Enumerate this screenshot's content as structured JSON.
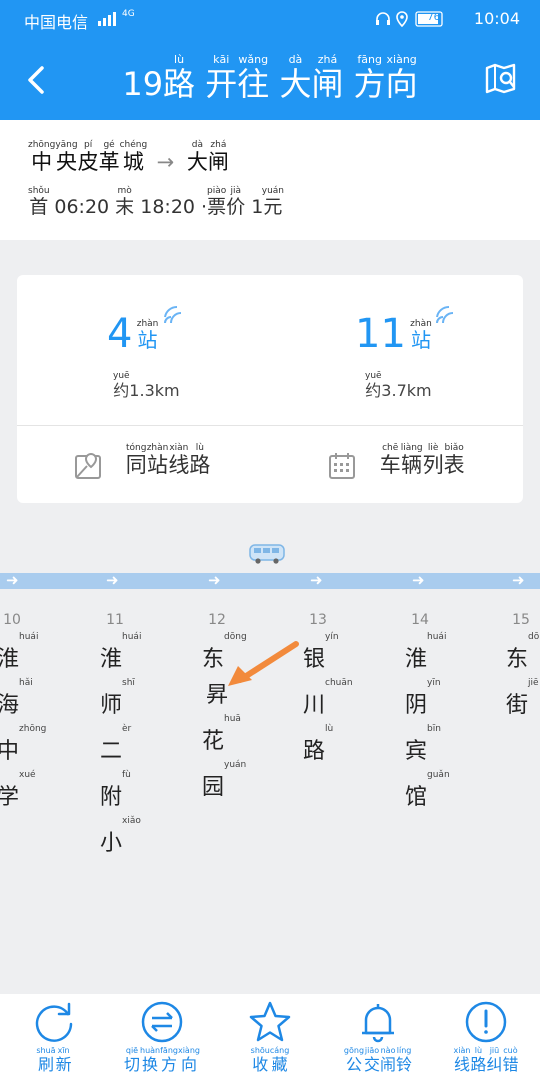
{
  "status_bar": {
    "carrier": "中国电信",
    "network": "4G",
    "battery": "76",
    "time": "10:04"
  },
  "header": {
    "title": [
      {
        "t": "19",
        "p": ""
      },
      {
        "t": "路",
        "p": "lù"
      },
      {
        "t": " ",
        "p": ""
      },
      {
        "t": "开",
        "p": "kāi"
      },
      {
        "t": "往",
        "p": "wǎng"
      },
      {
        "t": " ",
        "p": ""
      },
      {
        "t": "大",
        "p": "dà"
      },
      {
        "t": "闸",
        "p": "zhá"
      },
      {
        "t": " ",
        "p": ""
      },
      {
        "t": "方",
        "p": "fāng"
      },
      {
        "t": "向",
        "p": "xiàng"
      }
    ]
  },
  "route_info": {
    "from": [
      {
        "t": "中",
        "p": "zhōng"
      },
      {
        "t": "央",
        "p": "yāng"
      },
      {
        "t": "皮",
        "p": "pí"
      },
      {
        "t": "革",
        "p": "gé"
      },
      {
        "t": "城",
        "p": "chéng"
      }
    ],
    "arrow": "→",
    "to": [
      {
        "t": "大",
        "p": "dà"
      },
      {
        "t": "闸",
        "p": "zhá"
      }
    ],
    "first_label": {
      "t": "首",
      "p": "shǒu"
    },
    "first_time": "06:20",
    "last_label": {
      "t": "末",
      "p": "mò"
    },
    "last_time": "18:20",
    "fare_label": [
      {
        "t": "票",
        "p": "piào"
      },
      {
        "t": "价",
        "p": "jià"
      }
    ],
    "fare_prefix": "·",
    "fare_value": "1",
    "fare_unit": {
      "t": "元",
      "p": "yuán"
    }
  },
  "buses": [
    {
      "stops": "4",
      "unit": {
        "t": "站",
        "p": "zhàn"
      },
      "dist_prefix": {
        "t": "约",
        "p": "yuē"
      },
      "dist": "1.3km"
    },
    {
      "stops": "11",
      "unit": {
        "t": "站",
        "p": "zhàn"
      },
      "dist_prefix": {
        "t": "约",
        "p": "yuē"
      },
      "dist": "3.7km"
    }
  ],
  "card_buttons": [
    {
      "icon": "map-pin-icon",
      "label": [
        {
          "t": "同",
          "p": "tóng"
        },
        {
          "t": "站",
          "p": "zhàn"
        },
        {
          "t": "线",
          "p": "xiàn"
        },
        {
          "t": "路",
          "p": "lù"
        }
      ]
    },
    {
      "icon": "calendar-icon",
      "label": [
        {
          "t": "车",
          "p": "chē"
        },
        {
          "t": "辆",
          "p": "liàng"
        },
        {
          "t": "列",
          "p": "liè"
        },
        {
          "t": "表",
          "p": "biǎo"
        }
      ]
    }
  ],
  "stops": [
    {
      "index": "10",
      "chars": [
        {
          "t": "淮",
          "p": "huái"
        },
        {
          "t": "海",
          "p": "hǎi"
        },
        {
          "t": "中",
          "p": "zhōng"
        },
        {
          "t": "学",
          "p": "xué"
        }
      ]
    },
    {
      "index": "11",
      "chars": [
        {
          "t": "淮",
          "p": "huái"
        },
        {
          "t": "师",
          "p": "shī"
        },
        {
          "t": "二",
          "p": "èr"
        },
        {
          "t": "附",
          "p": "fù"
        },
        {
          "t": "小",
          "p": "xiǎo"
        }
      ]
    },
    {
      "index": "12",
      "chars": [
        {
          "t": "东",
          "p": "dōng"
        },
        {
          "t": "昇",
          "p": ""
        },
        {
          "t": "花",
          "p": "huā"
        },
        {
          "t": "园",
          "p": "yuán"
        }
      ]
    },
    {
      "index": "13",
      "chars": [
        {
          "t": "银",
          "p": "yín"
        },
        {
          "t": "川",
          "p": "chuān"
        },
        {
          "t": "路",
          "p": "lù"
        }
      ]
    },
    {
      "index": "14",
      "chars": [
        {
          "t": "淮",
          "p": "huái"
        },
        {
          "t": "阴",
          "p": "yīn"
        },
        {
          "t": "宾",
          "p": "bīn"
        },
        {
          "t": "馆",
          "p": "guǎn"
        }
      ]
    },
    {
      "index": "15",
      "chars": [
        {
          "t": "东",
          "p": "dōng"
        },
        {
          "t": "街",
          "p": "jiē"
        }
      ]
    }
  ],
  "bottom_tabs": [
    {
      "icon": "refresh-icon",
      "label": [
        {
          "t": "刷",
          "p": "shuā"
        },
        {
          "t": "新",
          "p": "xīn"
        }
      ]
    },
    {
      "icon": "switch-direction-icon",
      "label": [
        {
          "t": "切",
          "p": "qiē"
        },
        {
          "t": "换",
          "p": "huàn"
        },
        {
          "t": "方",
          "p": "fāng"
        },
        {
          "t": "向",
          "p": "xiàng"
        }
      ]
    },
    {
      "icon": "star-icon",
      "label": [
        {
          "t": "收",
          "p": "shōu"
        },
        {
          "t": "藏",
          "p": "cáng"
        }
      ]
    },
    {
      "icon": "bell-icon",
      "label": [
        {
          "t": "公",
          "p": "gōng"
        },
        {
          "t": "交",
          "p": "jiāo"
        },
        {
          "t": "闹",
          "p": "nào"
        },
        {
          "t": "铃",
          "p": "líng"
        }
      ]
    },
    {
      "icon": "info-icon",
      "label": [
        {
          "t": "线",
          "p": "xiàn"
        },
        {
          "t": "路",
          "p": "lù"
        },
        {
          "t": "纠",
          "p": "jiū"
        },
        {
          "t": "错",
          "p": "cuò"
        }
      ]
    }
  ],
  "colors": {
    "primary": "#2196f3",
    "track": "#a9ccee",
    "arrow_annotation": "#f28a3c"
  }
}
